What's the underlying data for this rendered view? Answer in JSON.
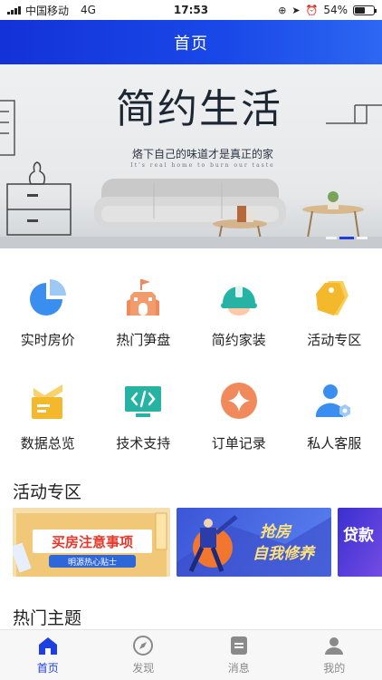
{
  "status_bar": {
    "carrier": "中国移动",
    "network": "4G",
    "time": "17:53",
    "battery_percent": "54%",
    "battery_level": 0.54
  },
  "nav": {
    "title": "首页"
  },
  "banner": {
    "headline": "简约生活",
    "subtitle": "烙下自己的味道才是真正的家",
    "subtitle_en": "It's real home to burn our taste"
  },
  "grid": [
    {
      "label": "实时房价",
      "icon": "pie-chart-icon"
    },
    {
      "label": "热门笋盘",
      "icon": "building-icon"
    },
    {
      "label": "简约家装",
      "icon": "helmet-icon"
    },
    {
      "label": "活动专区",
      "icon": "tag-icon"
    },
    {
      "label": "数据总览",
      "icon": "folder-icon"
    },
    {
      "label": "技术支持",
      "icon": "code-icon"
    },
    {
      "label": "订单记录",
      "icon": "coin-icon"
    },
    {
      "label": "私人客服",
      "icon": "user-settings-icon"
    }
  ],
  "sections": {
    "activity": "活动专区",
    "hot_topics": "热门主题"
  },
  "promos": [
    {
      "title": "买房注意事项",
      "tag": "明源热心贴士"
    },
    {
      "title1": "抢房",
      "title2": "自我修养"
    },
    {
      "title": "贷款"
    }
  ],
  "tabs": [
    {
      "label": "首页",
      "icon": "home-icon",
      "active": true
    },
    {
      "label": "发现",
      "icon": "compass-icon",
      "active": false
    },
    {
      "label": "消息",
      "icon": "message-icon",
      "active": false
    },
    {
      "label": "我的",
      "icon": "profile-icon",
      "active": false
    }
  ],
  "colors": {
    "brand": "#1b3fe0",
    "blue_icon": "#3a8ef0",
    "orange_icon": "#f08a5d",
    "teal_icon": "#27b3a3",
    "yellow_icon": "#f3b82b"
  }
}
